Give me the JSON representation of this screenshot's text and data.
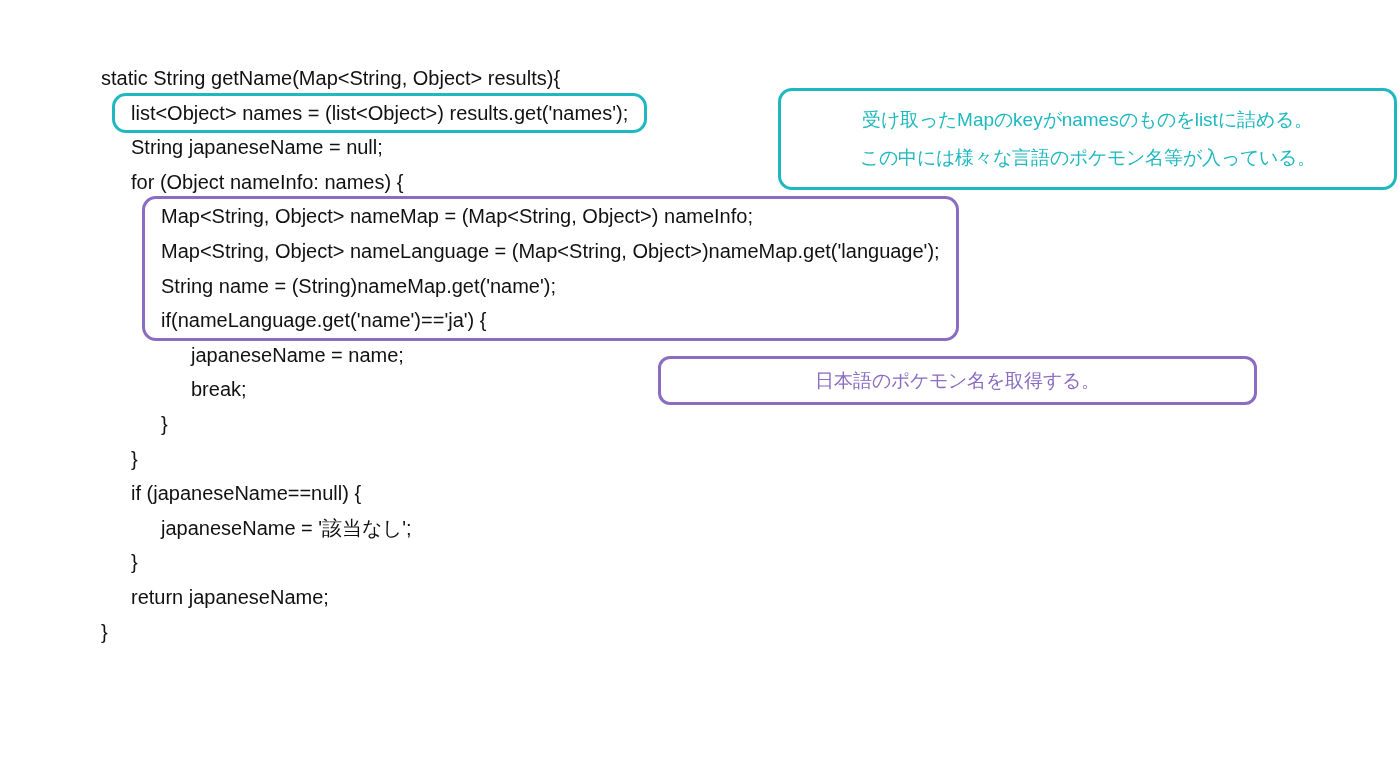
{
  "code": [
    {
      "kind": "line",
      "text": "static String getName(Map<String, Object> results){",
      "children": [
        {
          "kind": "frame",
          "color": "#1fb8c0",
          "children": [
            {
              "kind": "line",
              "text": "list<Object> names = (list<Object>) results.get('names');"
            }
          ]
        },
        {
          "kind": "line",
          "text": "String japaneseName = null;"
        },
        {
          "kind": "line",
          "text": "for (Object nameInfo: names) {",
          "children": [
            {
              "kind": "frame",
              "color": "#8a6cc2",
              "children": [
                {
                  "kind": "line",
                  "text": "Map<String, Object> nameMap = (Map<String, Object>) nameInfo;"
                },
                {
                  "kind": "line",
                  "text": "Map<String, Object> nameLanguage = (Map<String, Object>)nameMap.get('language');"
                },
                {
                  "kind": "line",
                  "text": "String name = (String)nameMap.get('name');"
                },
                {
                  "kind": "line",
                  "text": "if(nameLanguage.get('name')=='ja') {"
                }
              ]
            },
            {
              "kind": "body",
              "children": [
                {
                  "kind": "line",
                  "text": "japaneseName = name;"
                },
                {
                  "kind": "line",
                  "text": "break;"
                }
              ]
            },
            {
              "kind": "line",
              "text": "}"
            }
          ]
        },
        {
          "kind": "line",
          "text": "}"
        },
        {
          "kind": "line",
          "text": "if (japaneseName==null) {",
          "children": [
            {
              "kind": "line",
              "text": "japaneseName = '該当なし';"
            }
          ]
        },
        {
          "kind": "line",
          "text": "}"
        },
        {
          "kind": "line",
          "text": "return japaneseName;"
        }
      ]
    },
    {
      "kind": "line",
      "text": "}"
    }
  ],
  "annotations": [
    {
      "kind": "callout",
      "color": "#1fb8c0",
      "lines": [
        "受け取ったMapのkeyがnamesのものをlistに詰める。",
        "この中には様々な言語のポケモン名等が入っている。"
      ]
    },
    {
      "kind": "note",
      "color": "#8a6cc2",
      "lines": [
        "日本語のポケモン名を取得する。"
      ]
    }
  ]
}
